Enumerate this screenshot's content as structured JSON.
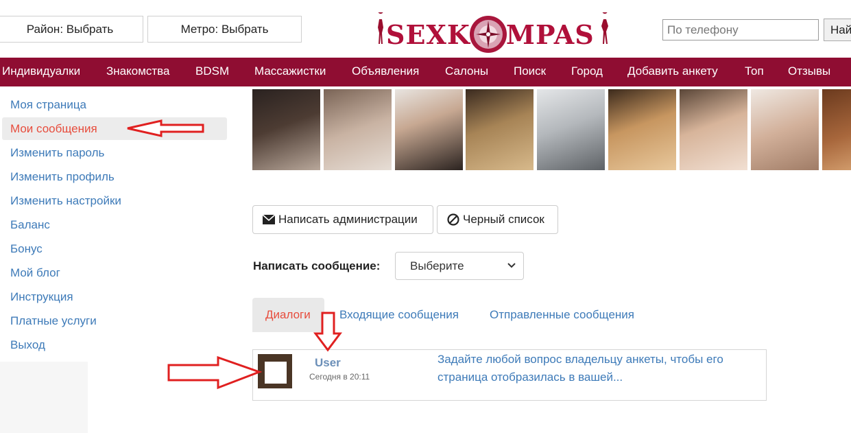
{
  "header": {
    "district_button": "Район: Выбрать",
    "metro_button": "Метро: Выбрать",
    "logo_text_left": "SEXK",
    "logo_text_right": "MPAS",
    "phone_placeholder": "По телефону",
    "find_button": "Най"
  },
  "nav": {
    "items": [
      "Индивидуалки",
      "Знакомства",
      "BDSM",
      "Массажистки",
      "Объявления",
      "Салоны",
      "Поиск",
      "Город",
      "Добавить анкету",
      "Топ",
      "Отзывы"
    ]
  },
  "sidebar": {
    "items": [
      {
        "label": "Моя страница"
      },
      {
        "label": "Мои сообщения"
      },
      {
        "label": "Изменить пароль"
      },
      {
        "label": "Изменить профиль"
      },
      {
        "label": "Изменить настройки"
      },
      {
        "label": "Баланс"
      },
      {
        "label": "Бонус"
      },
      {
        "label": "Мой блог"
      },
      {
        "label": "Инструкция"
      },
      {
        "label": "Платные услуги"
      },
      {
        "label": "Выход"
      }
    ]
  },
  "actions": {
    "write_admin": "Написать администрации",
    "blacklist": "Черный список"
  },
  "compose": {
    "label": "Написать сообщение:",
    "select_value": "Выберите"
  },
  "tabs": {
    "dialogs": "Диалоги",
    "inbox": "Входящие сообщения",
    "sent": "Отправленные сообщения"
  },
  "dialog": {
    "user": "User",
    "time": "Сегодня в 20:11",
    "text": "Задайте любой вопрос владельцу анкеты, чтобы его страница отобразилась в вашей..."
  },
  "colors": {
    "nav_bg": "#8f0d32",
    "link": "#3d7ab8",
    "active": "#e74c3c",
    "annotation_arrow": "#e02020"
  }
}
